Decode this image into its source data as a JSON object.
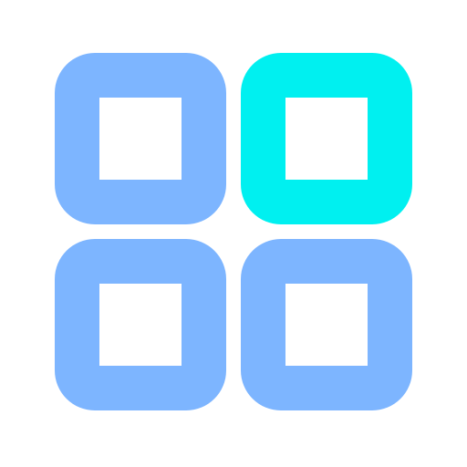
{
  "icon": {
    "name": "app-grid-icon",
    "tiles": [
      {
        "id": "tile-tl",
        "name": "grid-tile-top-left",
        "color": "#7db5ff",
        "active": false
      },
      {
        "id": "tile-tr",
        "name": "grid-tile-top-right",
        "color": "#00f0f0",
        "active": true
      },
      {
        "id": "tile-bl",
        "name": "grid-tile-bottom-left",
        "color": "#7db5ff",
        "active": false
      },
      {
        "id": "tile-br",
        "name": "grid-tile-bottom-right",
        "color": "#7db5ff",
        "active": false
      }
    ]
  }
}
